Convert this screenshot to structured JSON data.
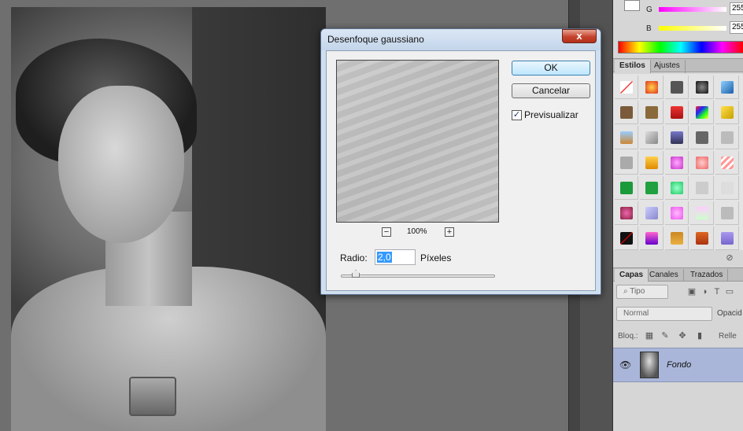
{
  "dialog": {
    "title": "Desenfoque gaussiano",
    "close_label": "x",
    "ok_label": "OK",
    "cancel_label": "Cancelar",
    "preview_label": "Previsualizar",
    "preview_checked": true,
    "check_mark": "✓",
    "zoom_out": "−",
    "zoom_in": "+",
    "zoom_level": "100%",
    "radius_label": "Radio:",
    "radius_value": "2,0",
    "radius_unit": "Píxeles"
  },
  "color_panel": {
    "g_label": "G",
    "g_value": "255",
    "b_label": "B",
    "b_value": "255"
  },
  "styles_panel": {
    "tabs": [
      "Estilos",
      "Ajustes"
    ],
    "delete_icon": "⊘"
  },
  "layers_panel": {
    "tabs": [
      "Capas",
      "Canales",
      "Trazados"
    ],
    "filter_kind": "Tipo",
    "blend_mode": "Normal",
    "opacity_label": "Opacid",
    "lock_label": "Bloq.:",
    "fill_label": "Relle",
    "layer_name": "Fondo",
    "eye_icon": "👁"
  },
  "colors": {
    "accent": "#3399ff",
    "layer_selected": "#a9b6d9",
    "close_red": "#c5432c"
  }
}
